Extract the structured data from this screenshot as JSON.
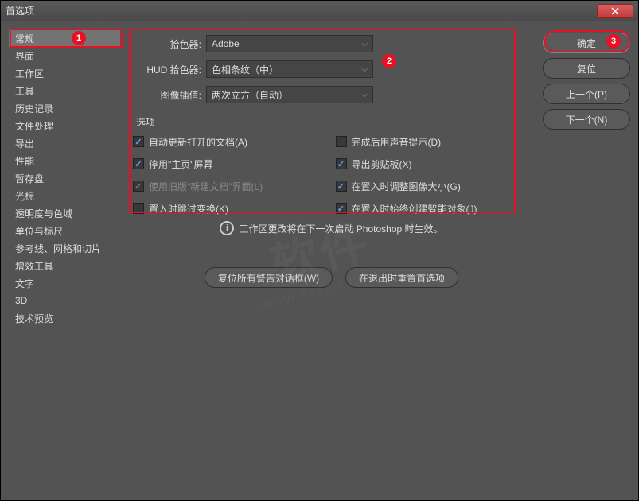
{
  "window": {
    "title": "首选项"
  },
  "sidebar": {
    "items": [
      {
        "label": "常规",
        "selected": true
      },
      {
        "label": "界面"
      },
      {
        "label": "工作区"
      },
      {
        "label": "工具"
      },
      {
        "label": "历史记录"
      },
      {
        "label": "文件处理"
      },
      {
        "label": "导出"
      },
      {
        "label": "性能"
      },
      {
        "label": "暂存盘"
      },
      {
        "label": "光标"
      },
      {
        "label": "透明度与色域"
      },
      {
        "label": "单位与标尺"
      },
      {
        "label": "参考线、网格和切片"
      },
      {
        "label": "增效工具"
      },
      {
        "label": "文字"
      },
      {
        "label": "3D"
      },
      {
        "label": "技术预览"
      }
    ]
  },
  "form": {
    "picker_label": "拾色器:",
    "picker_value": "Adobe",
    "hud_label": "HUD 拾色器:",
    "hud_value": "色相条纹（中）",
    "interp_label": "图像插值:",
    "interp_value": "两次立方（自动）",
    "options_label": "选项"
  },
  "options_left": [
    {
      "label": "自动更新打开的文档(A)",
      "checked": true
    },
    {
      "label": "停用\"主页\"屏幕",
      "checked": true
    },
    {
      "label": "使用旧版\"新建文档\"界面(L)",
      "checked": true,
      "disabled": true
    },
    {
      "label": "置入时跳过变换(K)",
      "checked": false
    }
  ],
  "options_right": [
    {
      "label": "完成后用声音提示(D)",
      "checked": false
    },
    {
      "label": "导出剪贴板(X)",
      "checked": true
    },
    {
      "label": "在置入时调整图像大小(G)",
      "checked": true
    },
    {
      "label": "在置入时始终创建智能对象(J)",
      "checked": true
    }
  ],
  "info_text": "工作区更改将在下一次启动 Photoshop 时生效。",
  "buttons": {
    "reset_warnings": "复位所有警告对话框(W)",
    "reset_prefs": "在退出时重置首选项"
  },
  "right_buttons": {
    "ok": "确定",
    "reset": "复位",
    "prev": "上一个(P)",
    "next": "下一个(N)"
  },
  "annotations": {
    "badge1": "1",
    "badge2": "2",
    "badge3": "3"
  },
  "watermark": {
    "main": "软件",
    "sub": "WWW.RJZXW.COM"
  }
}
